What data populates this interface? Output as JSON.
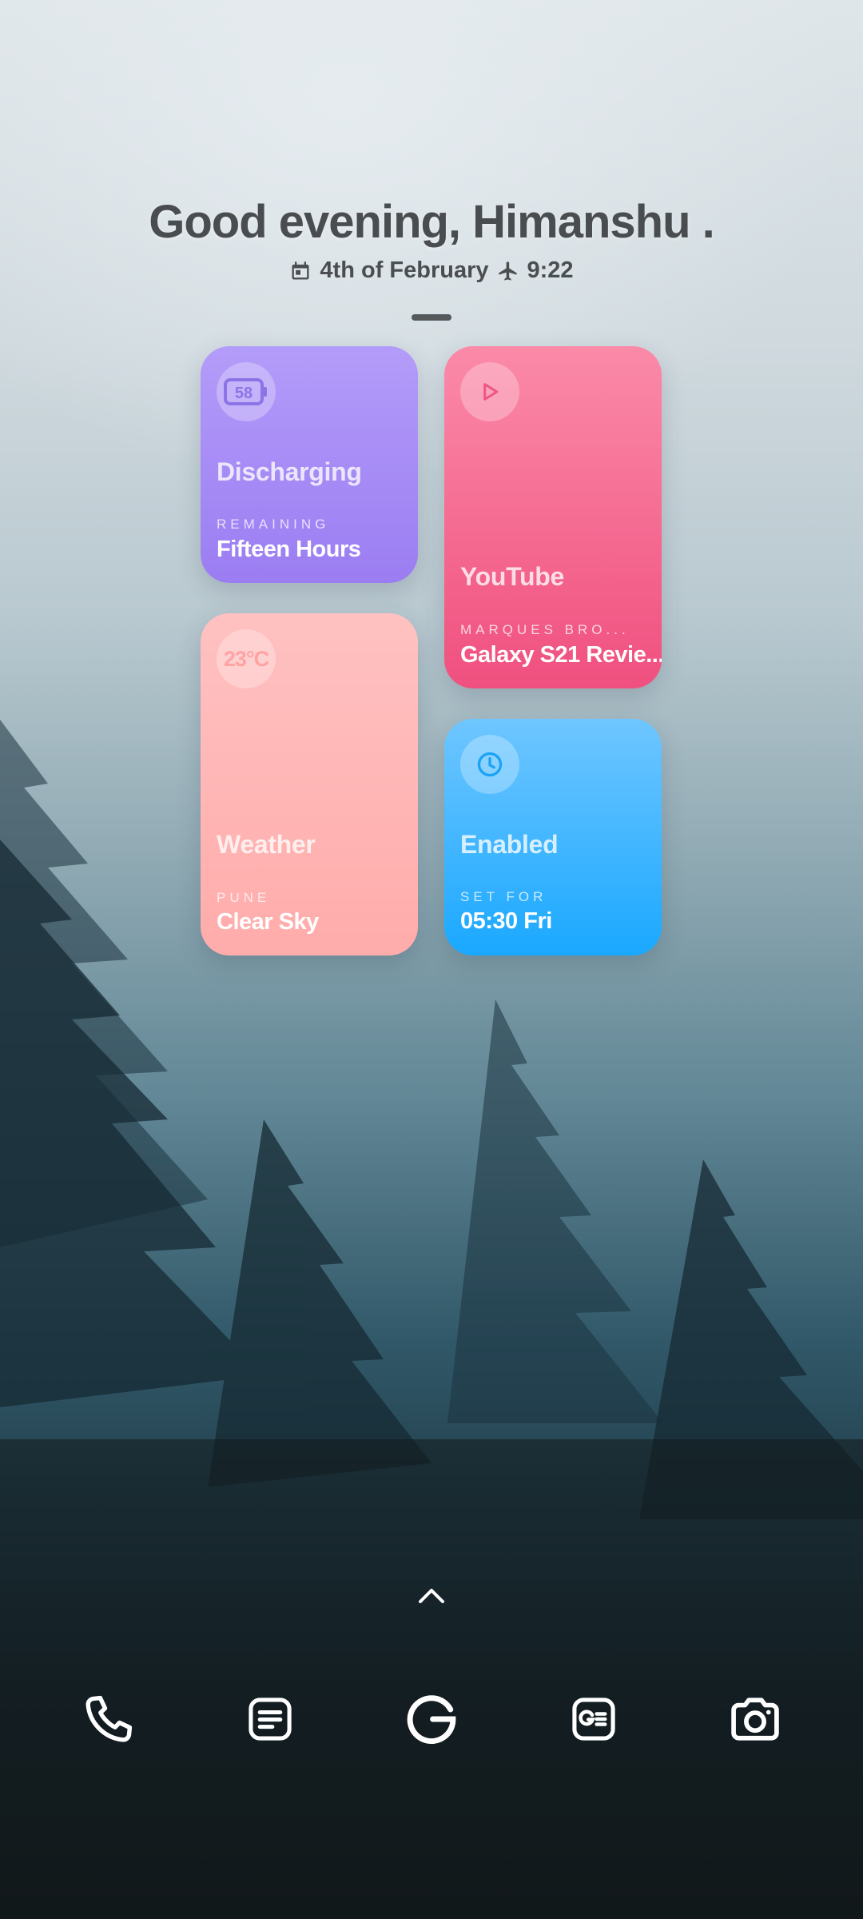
{
  "header": {
    "greeting": "Good evening, Himanshu .",
    "date": "4th of February",
    "time": "9:22",
    "calendar_icon": "calendar-icon",
    "airplane_icon": "airplane-icon"
  },
  "cards": {
    "battery": {
      "level": "58",
      "title": "Discharging",
      "caption": "REMAINING",
      "value": "Fifteen Hours",
      "color": "#9b7df2"
    },
    "youtube": {
      "icon": "play-icon",
      "title": "YouTube",
      "caption": "MARQUES BRO...",
      "value": "Galaxy S21 Revie...",
      "color": "#f0507f"
    },
    "weather": {
      "temp": "23°C",
      "title": "Weather",
      "caption": "PUNE",
      "value": "Clear Sky",
      "color": "#ffacab"
    },
    "alarm": {
      "icon": "clock-icon",
      "title": "Enabled",
      "caption": "SET FOR",
      "value": "05:30 Fri",
      "color": "#1aa8ff"
    }
  },
  "dock": {
    "apps": [
      "phone-icon",
      "notes-icon",
      "google-icon",
      "news-icon",
      "camera-icon"
    ]
  }
}
